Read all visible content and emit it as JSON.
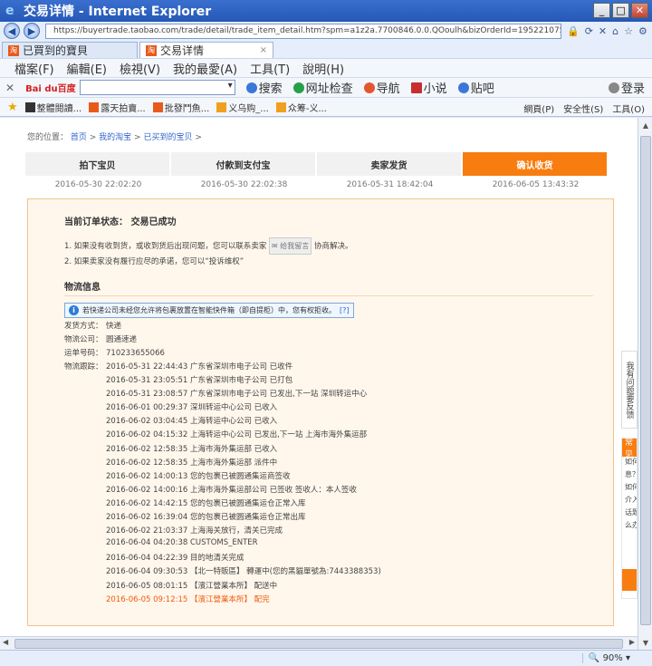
{
  "window": {
    "title": "交易详情 - Internet Explorer",
    "min": "_",
    "max": "□",
    "close": "✕"
  },
  "address": {
    "url": "https://buyertrade.taobao.com/trade/detail/trade_item_detail.htm?spm=a1z2a.7700846.0.0.QOoulh&bizOrderId=1952210754939321"
  },
  "tabs": [
    {
      "label": "已買到的寶貝"
    },
    {
      "label": "交易详情",
      "close": "×"
    }
  ],
  "menu": [
    "檔案(F)",
    "編輯(E)",
    "檢視(V)",
    "我的最愛(A)",
    "工具(T)",
    "說明(H)"
  ],
  "baidu": {
    "logo": "Bai du百度",
    "items": [
      "搜索",
      "网址检查",
      "导航",
      "小说",
      "贴吧",
      "登录"
    ]
  },
  "favorites": {
    "items": [
      "整體閱讀...",
      "露天拍賣...",
      "批發鬥魚...",
      "义乌购_...",
      "众筹-义..."
    ],
    "tools": [
      "網頁(P)",
      "安全性(S)",
      "工具(O)"
    ]
  },
  "page": {
    "breadcrumb": {
      "label": "您的位置：",
      "links": [
        "首页",
        "我的淘宝",
        "已买到的宝贝"
      ]
    },
    "steps": [
      {
        "label": "拍下宝贝",
        "time": "2016-05-30 22:02:20"
      },
      {
        "label": "付款到支付宝",
        "time": "2016-05-30 22:02:38"
      },
      {
        "label": "卖家发货",
        "time": "2016-05-31 18:42:04"
      },
      {
        "label": "确认收货",
        "time": "2016-06-05 13:43:32"
      }
    ],
    "status_title": "当前订单状态： 交易已成功",
    "tips": {
      "tip1_pre": "1.   如果没有收到货，或收到货后出现问题，您可以联系卖家",
      "tip1_btn": "给我留言",
      "tip1_post": "协商解决。",
      "tip2": "2.   如果卖家没有履行应尽的承诺，您可以“投诉维权”"
    },
    "logistics_title": "物流信息",
    "notice": {
      "text": "若快递公司未经您允许将包裹放置在智能快件箱（即自提柜）中，您有权拒收。",
      "link": "[?]"
    },
    "ship_method_label": "发货方式：",
    "ship_method": "快递",
    "company_label": "物流公司：",
    "company": "圆通速递",
    "waybill_label": "运单号码：",
    "waybill": "710233655066",
    "tracking_label": "物流跟踪：",
    "tracking": [
      "2016-05-31 22:44:43 广东省深圳市电子公司 已收件",
      "2016-05-31 23:05:51 广东省深圳市电子公司 已打包",
      "2016-05-31 23:08:57 广东省深圳市电子公司 已发出,下一站 深圳转运中心",
      "2016-06-01 00:29:37 深圳转运中心公司 已收入",
      "2016-06-02 03:04:45 上海转运中心公司 已收入",
      "2016-06-02 04:15:32 上海转运中心公司 已发出,下一站 上海市海外集运部",
      "2016-06-02 12:58:35 上海市海外集运部 已收入",
      "2016-06-02 12:58:35 上海市海外集运部 派件中",
      "2016-06-02 14:00:13 您的包裹已被圆通集运商签收",
      "2016-06-02 14:00:16 上海市海外集运部公司 已签收 签收人：本人签收",
      "2016-06-02 14:42:15 您的包裹已被圆通集运仓正常入库",
      "2016-06-02 16:39:04 您的包裹已被圆通集运仓正常出库",
      "2016-06-02 21:03:37 上海海关放行，清关已完成",
      "2016-06-04 04:20:38 CUSTOMS_ENTER",
      "2016-06-04 04:22:39 目的地清关完成",
      "2016-06-04 09:30:53 【北一特販區】 轉運中(您的黑貓單號為:7443388353)",
      "2016-06-05 08:01:15 【濱江營業本所】 配送中",
      "2016-06-05 09:12:15 【濱江營業本所】 配完"
    ],
    "feedback": "我有问题要反馈",
    "side": {
      "head": "常见",
      "lines": [
        "如何",
        "息？",
        "如何",
        "介入",
        "话题",
        "么办"
      ]
    }
  },
  "statusbar": {
    "zoom": "90%"
  },
  "colors": {
    "accent": "#f87d10",
    "latest": "#f25a0d",
    "link": "#3366cc"
  }
}
